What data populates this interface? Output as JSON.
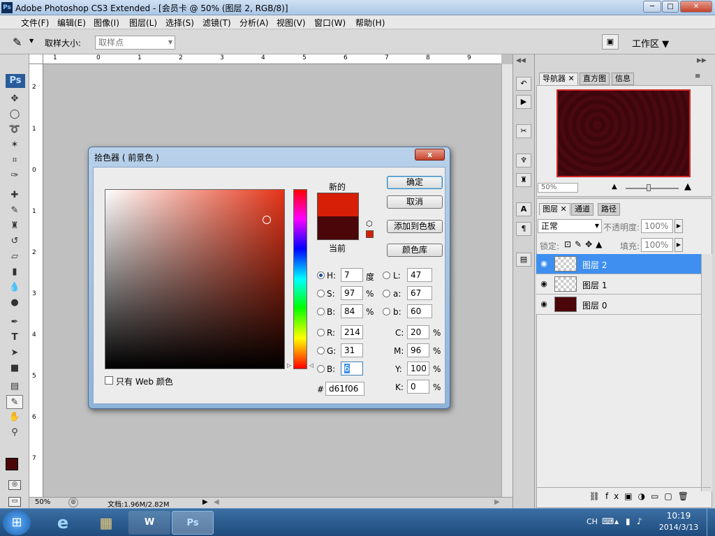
{
  "titlebar": {
    "app_icon": "Ps",
    "title": "Adobe Photoshop CS3 Extended - [会员卡 @ 50% (图层 2, RGB/8)]",
    "min": "─",
    "max": "□",
    "close": "✕"
  },
  "menubar": {
    "items": [
      "文件(F)",
      "编辑(E)",
      "图像(I)",
      "图层(L)",
      "选择(S)",
      "滤镜(T)",
      "分析(A)",
      "视图(V)",
      "窗口(W)",
      "帮助(H)"
    ]
  },
  "options": {
    "sample_label": "取样大小:",
    "sample_value": "取样点",
    "workspace": "工作区 ▼"
  },
  "toolbox": {
    "ps_logo": "Ps"
  },
  "rulers": {
    "h": [
      "1",
      "0",
      "1",
      "2",
      "3",
      "4",
      "5",
      "6",
      "7",
      "8",
      "9"
    ],
    "v": [
      "2",
      "1",
      "0",
      "1",
      "2",
      "3",
      "4",
      "5",
      "6",
      "7"
    ]
  },
  "status": {
    "zoom": "50%",
    "doc": "文档:1.96M/2.82M"
  },
  "navigator": {
    "tabs": [
      "导航器",
      "直方图",
      "信息"
    ],
    "zoom": "50%"
  },
  "layers": {
    "tabs": [
      "图层",
      "通道",
      "路径"
    ],
    "blend": "正常",
    "opacity_label": "不透明度:",
    "opacity": "100%",
    "lock_label": "锁定:",
    "fill_label": "填充:",
    "fill": "100%",
    "rows": [
      {
        "name": "图层 2",
        "selected": true
      },
      {
        "name": "图层 1",
        "selected": false
      },
      {
        "name": "图层 0",
        "selected": false
      }
    ]
  },
  "dialog": {
    "title": "拾色器 ( 前景色 )",
    "close": "x",
    "new_label": "新的",
    "current_label": "当前",
    "ok": "确定",
    "cancel": "取消",
    "add_swatch": "添加到色板",
    "libraries": "颜色库",
    "web_only": "只有 Web 颜色",
    "new_color": "#d61f06",
    "current_color": "#4a0608",
    "fields": {
      "H": {
        "label": "H:",
        "value": "7",
        "unit": "度"
      },
      "S": {
        "label": "S:",
        "value": "97",
        "unit": "%"
      },
      "Bv": {
        "label": "B:",
        "value": "84",
        "unit": "%"
      },
      "R": {
        "label": "R:",
        "value": "214"
      },
      "G": {
        "label": "G:",
        "value": "31"
      },
      "Bl": {
        "label": "B:",
        "value": "6"
      },
      "hex_label": "#",
      "hex": "d61f06",
      "L": {
        "label": "L:",
        "value": "47"
      },
      "a": {
        "label": "a:",
        "value": "67"
      },
      "b": {
        "label": "b:",
        "value": "60"
      },
      "C": {
        "label": "C:",
        "value": "20",
        "unit": "%"
      },
      "M": {
        "label": "M:",
        "value": "96",
        "unit": "%"
      },
      "Y": {
        "label": "Y:",
        "value": "100",
        "unit": "%"
      },
      "K": {
        "label": "K:",
        "value": "0",
        "unit": "%"
      }
    }
  },
  "taskbar": {
    "start": "⊞",
    "ps": "Ps",
    "lang": "CH",
    "time": "10:19",
    "date": "2014/3/13"
  }
}
